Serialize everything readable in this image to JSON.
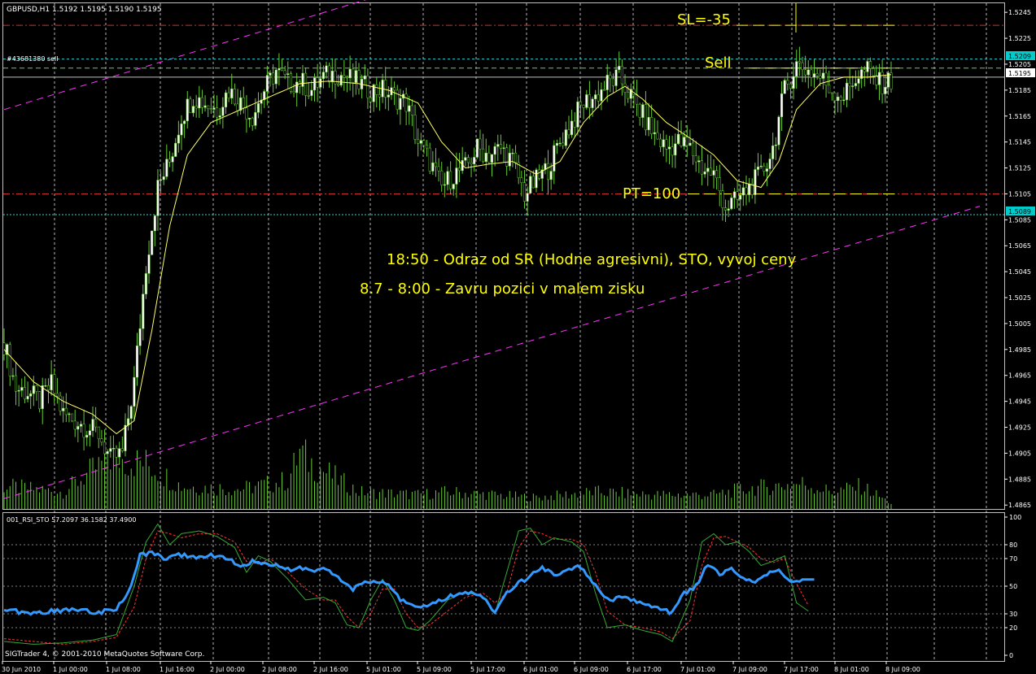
{
  "header": {
    "symbol_info": "GBPUSD,H1  1.5192 1.5195 1.5190 1.5195",
    "order_label": "#43681380 sell"
  },
  "colors": {
    "background": "#000000",
    "bull_candle": "#ffffff",
    "bear_candle": "#000000",
    "wick": "#66cc33",
    "ma_line": "#ffff66",
    "channel": "#ff33ff",
    "sl_tp_line": "#cc3333",
    "order_line": "#66cc66",
    "current_price_line": "#c0c0c0",
    "rsi_line": "#3399ff",
    "sto_main": "#33aa33",
    "sto_signal": "#ff3333",
    "volume": "#66cc33",
    "price_tag_blue": "#00cccc"
  },
  "annotations": {
    "sl": "SL=-35",
    "sell": "Sell",
    "pt": "PT=100",
    "note1": "18:50 - Odraz od SR (Hodne agresivni), STO, vyvoj ceny",
    "note2": "8.7 - 8:00 - Zavru pozici v malem zisku"
  },
  "price_tags": {
    "order_price": "1.5209",
    "current_price": "1.5195",
    "support_price": "1.5089"
  },
  "indicator": {
    "title": "001_RSI_STO  57.2097 36.1582 37.4900"
  },
  "footer": {
    "copyright": "SIGTrader 4, © 2001-2010 MetaQuotes Software Corp."
  },
  "chart_data": {
    "type": "candlestick",
    "symbol": "GBPUSD",
    "timeframe": "H1",
    "y_ticks": [
      "1.5245",
      "1.5225",
      "1.5205",
      "1.5185",
      "1.5165",
      "1.5145",
      "1.5125",
      "1.5105",
      "1.5085",
      "1.5065",
      "1.5045",
      "1.5025",
      "1.5005",
      "1.4985",
      "1.4965",
      "1.4945",
      "1.4925",
      "1.4905",
      "1.4885",
      "1.4865"
    ],
    "ylim": [
      1.4862,
      1.5252
    ],
    "x_ticks": [
      "30 Jun 2010",
      "1 Jul 00:00",
      "1 Jul 08:00",
      "1 Jul 16:00",
      "2 Jul 00:00",
      "2 Jul 08:00",
      "2 Jul 16:00",
      "5 Jul 01:00",
      "5 Jul 09:00",
      "5 Jul 17:00",
      "6 Jul 01:00",
      "6 Jul 09:00",
      "6 Jul 17:00",
      "7 Jul 01:00",
      "7 Jul 09:00",
      "7 Jul 17:00",
      "8 Jul 01:00",
      "8 Jul 09:00"
    ],
    "levels": {
      "stop_loss": 1.5235,
      "order_open": 1.5209,
      "sell_line": 1.5202,
      "current": 1.5195,
      "take_profit": 1.5105,
      "support": 1.5089
    },
    "close_anchors": [
      [
        0,
        1.499
      ],
      [
        4,
        1.4955
      ],
      [
        8,
        1.4952
      ],
      [
        12,
        1.4945
      ],
      [
        16,
        1.4958
      ],
      [
        20,
        1.4935
      ],
      [
        24,
        1.493
      ],
      [
        28,
        1.4925
      ],
      [
        32,
        1.492
      ],
      [
        36,
        1.49
      ],
      [
        40,
        1.4905
      ],
      [
        44,
        1.496
      ],
      [
        48,
        1.505
      ],
      [
        52,
        1.511
      ],
      [
        56,
        1.513
      ],
      [
        60,
        1.5165
      ],
      [
        64,
        1.518
      ],
      [
        68,
        1.5175
      ],
      [
        72,
        1.517
      ],
      [
        76,
        1.5185
      ],
      [
        80,
        1.5175
      ],
      [
        84,
        1.5165
      ],
      [
        88,
        1.5185
      ],
      [
        92,
        1.52
      ],
      [
        96,
        1.519
      ],
      [
        100,
        1.5192
      ],
      [
        104,
        1.5185
      ],
      [
        108,
        1.5195
      ],
      [
        112,
        1.5198
      ],
      [
        116,
        1.5195
      ],
      [
        120,
        1.519
      ],
      [
        124,
        1.5185
      ],
      [
        128,
        1.5185
      ],
      [
        132,
        1.518
      ],
      [
        136,
        1.5175
      ],
      [
        140,
        1.5145
      ],
      [
        144,
        1.513
      ],
      [
        148,
        1.511
      ],
      [
        152,
        1.512
      ],
      [
        156,
        1.5125
      ],
      [
        160,
        1.514
      ],
      [
        164,
        1.5135
      ],
      [
        168,
        1.514
      ],
      [
        172,
        1.513
      ],
      [
        176,
        1.5105
      ],
      [
        180,
        1.5115
      ],
      [
        184,
        1.5125
      ],
      [
        188,
        1.5145
      ],
      [
        192,
        1.516
      ],
      [
        196,
        1.5175
      ],
      [
        200,
        1.518
      ],
      [
        204,
        1.519
      ],
      [
        208,
        1.5195
      ],
      [
        212,
        1.518
      ],
      [
        216,
        1.5165
      ],
      [
        220,
        1.515
      ],
      [
        224,
        1.514
      ],
      [
        228,
        1.5145
      ],
      [
        232,
        1.514
      ],
      [
        236,
        1.5125
      ],
      [
        240,
        1.512
      ],
      [
        244,
        1.5095
      ],
      [
        248,
        1.51
      ],
      [
        252,
        1.511
      ],
      [
        256,
        1.512
      ],
      [
        260,
        1.514
      ],
      [
        264,
        1.5185
      ],
      [
        268,
        1.5205
      ],
      [
        272,
        1.52
      ],
      [
        276,
        1.5195
      ],
      [
        280,
        1.5185
      ],
      [
        284,
        1.518
      ],
      [
        288,
        1.5195
      ],
      [
        292,
        1.52
      ],
      [
        296,
        1.519
      ],
      [
        300,
        1.5192
      ]
    ],
    "ma_anchors": [
      [
        0,
        1.4985
      ],
      [
        10,
        1.496
      ],
      [
        20,
        1.4945
      ],
      [
        30,
        1.4935
      ],
      [
        38,
        1.492
      ],
      [
        44,
        1.493
      ],
      [
        50,
        1.5
      ],
      [
        56,
        1.508
      ],
      [
        62,
        1.5135
      ],
      [
        70,
        1.516
      ],
      [
        80,
        1.517
      ],
      [
        90,
        1.518
      ],
      [
        100,
        1.519
      ],
      [
        110,
        1.5192
      ],
      [
        120,
        1.519
      ],
      [
        130,
        1.5185
      ],
      [
        140,
        1.5175
      ],
      [
        148,
        1.5145
      ],
      [
        156,
        1.5125
      ],
      [
        164,
        1.5128
      ],
      [
        172,
        1.513
      ],
      [
        180,
        1.512
      ],
      [
        188,
        1.513
      ],
      [
        196,
        1.516
      ],
      [
        204,
        1.518
      ],
      [
        210,
        1.5188
      ],
      [
        216,
        1.5178
      ],
      [
        224,
        1.516
      ],
      [
        232,
        1.5148
      ],
      [
        240,
        1.5135
      ],
      [
        248,
        1.5115
      ],
      [
        256,
        1.511
      ],
      [
        262,
        1.513
      ],
      [
        268,
        1.517
      ],
      [
        276,
        1.519
      ],
      [
        284,
        1.5195
      ],
      [
        292,
        1.5195
      ],
      [
        300,
        1.5197
      ]
    ],
    "volume_anchors": [
      [
        0,
        40
      ],
      [
        20,
        30
      ],
      [
        36,
        90
      ],
      [
        48,
        80
      ],
      [
        60,
        40
      ],
      [
        80,
        35
      ],
      [
        96,
        50
      ],
      [
        100,
        100
      ],
      [
        104,
        80
      ],
      [
        120,
        30
      ],
      [
        140,
        25
      ],
      [
        150,
        30
      ],
      [
        180,
        20
      ],
      [
        200,
        30
      ],
      [
        220,
        25
      ],
      [
        240,
        25
      ],
      [
        250,
        35
      ],
      [
        260,
        40
      ],
      [
        270,
        45
      ],
      [
        280,
        30
      ],
      [
        290,
        40
      ],
      [
        300,
        10
      ]
    ],
    "channel": {
      "upper": {
        "x0": 0,
        "y0": 1.517,
        "x1": 130,
        "y1": 1.526
      },
      "lower": {
        "x0": 0,
        "y0": 1.487,
        "x1": 300,
        "y1": 1.5075
      }
    },
    "indicator_panel": {
      "name": "001_RSI_STO",
      "y_ticks": [
        "100",
        "80",
        "70",
        "50",
        "30",
        "20",
        "0"
      ],
      "levels": [
        100,
        80,
        70,
        50,
        30,
        20,
        0
      ],
      "ylim": [
        0,
        100
      ],
      "rsi_anchors": [
        [
          0,
          34
        ],
        [
          8,
          30
        ],
        [
          16,
          32
        ],
        [
          24,
          33
        ],
        [
          32,
          31
        ],
        [
          38,
          34
        ],
        [
          42,
          45
        ],
        [
          46,
          72
        ],
        [
          50,
          75
        ],
        [
          54,
          70
        ],
        [
          58,
          73
        ],
        [
          64,
          71
        ],
        [
          70,
          72
        ],
        [
          76,
          70
        ],
        [
          80,
          64
        ],
        [
          84,
          68
        ],
        [
          90,
          66
        ],
        [
          96,
          62
        ],
        [
          100,
          64
        ],
        [
          104,
          60
        ],
        [
          108,
          62
        ],
        [
          112,
          58
        ],
        [
          118,
          48
        ],
        [
          122,
          52
        ],
        [
          126,
          54
        ],
        [
          130,
          50
        ],
        [
          134,
          40
        ],
        [
          138,
          36
        ],
        [
          142,
          35
        ],
        [
          146,
          38
        ],
        [
          150,
          42
        ],
        [
          154,
          44
        ],
        [
          158,
          45
        ],
        [
          162,
          42
        ],
        [
          166,
          30
        ],
        [
          170,
          45
        ],
        [
          174,
          52
        ],
        [
          178,
          57
        ],
        [
          182,
          64
        ],
        [
          186,
          58
        ],
        [
          190,
          60
        ],
        [
          194,
          66
        ],
        [
          198,
          56
        ],
        [
          202,
          44
        ],
        [
          206,
          40
        ],
        [
          210,
          43
        ],
        [
          214,
          38
        ],
        [
          218,
          36
        ],
        [
          222,
          33
        ],
        [
          226,
          31
        ],
        [
          230,
          45
        ],
        [
          234,
          50
        ],
        [
          238,
          66
        ],
        [
          242,
          58
        ],
        [
          246,
          62
        ],
        [
          250,
          56
        ],
        [
          254,
          54
        ],
        [
          258,
          58
        ],
        [
          262,
          63
        ],
        [
          266,
          52
        ],
        [
          270,
          55
        ],
        [
          274,
          55
        ]
      ],
      "sto_main_anchors": [
        [
          0,
          10
        ],
        [
          10,
          8
        ],
        [
          20,
          9
        ],
        [
          30,
          11
        ],
        [
          38,
          15
        ],
        [
          44,
          50
        ],
        [
          48,
          82
        ],
        [
          52,
          95
        ],
        [
          56,
          80
        ],
        [
          60,
          88
        ],
        [
          66,
          90
        ],
        [
          72,
          86
        ],
        [
          78,
          78
        ],
        [
          82,
          60
        ],
        [
          86,
          72
        ],
        [
          90,
          68
        ],
        [
          96,
          55
        ],
        [
          102,
          40
        ],
        [
          108,
          42
        ],
        [
          112,
          38
        ],
        [
          116,
          22
        ],
        [
          120,
          20
        ],
        [
          124,
          40
        ],
        [
          128,
          55
        ],
        [
          132,
          40
        ],
        [
          136,
          20
        ],
        [
          140,
          18
        ],
        [
          144,
          25
        ],
        [
          150,
          40
        ],
        [
          156,
          46
        ],
        [
          162,
          42
        ],
        [
          166,
          30
        ],
        [
          170,
          60
        ],
        [
          174,
          90
        ],
        [
          178,
          92
        ],
        [
          182,
          80
        ],
        [
          186,
          85
        ],
        [
          192,
          82
        ],
        [
          196,
          75
        ],
        [
          200,
          45
        ],
        [
          204,
          20
        ],
        [
          210,
          22
        ],
        [
          216,
          18
        ],
        [
          222,
          15
        ],
        [
          226,
          10
        ],
        [
          232,
          40
        ],
        [
          236,
          82
        ],
        [
          240,
          88
        ],
        [
          244,
          80
        ],
        [
          248,
          82
        ],
        [
          252,
          75
        ],
        [
          256,
          65
        ],
        [
          260,
          68
        ],
        [
          264,
          72
        ],
        [
          268,
          38
        ],
        [
          272,
          32
        ]
      ],
      "sto_signal_anchors": [
        [
          0,
          12
        ],
        [
          10,
          10
        ],
        [
          20,
          8
        ],
        [
          30,
          10
        ],
        [
          38,
          13
        ],
        [
          44,
          35
        ],
        [
          48,
          70
        ],
        [
          52,
          90
        ],
        [
          56,
          88
        ],
        [
          60,
          85
        ],
        [
          66,
          88
        ],
        [
          72,
          88
        ],
        [
          78,
          82
        ],
        [
          82,
          68
        ],
        [
          86,
          66
        ],
        [
          90,
          70
        ],
        [
          96,
          60
        ],
        [
          102,
          48
        ],
        [
          108,
          40
        ],
        [
          112,
          40
        ],
        [
          116,
          28
        ],
        [
          120,
          20
        ],
        [
          124,
          30
        ],
        [
          128,
          48
        ],
        [
          132,
          48
        ],
        [
          136,
          30
        ],
        [
          140,
          20
        ],
        [
          144,
          22
        ],
        [
          150,
          32
        ],
        [
          156,
          42
        ],
        [
          162,
          45
        ],
        [
          166,
          38
        ],
        [
          170,
          45
        ],
        [
          174,
          78
        ],
        [
          178,
          90
        ],
        [
          182,
          88
        ],
        [
          186,
          84
        ],
        [
          192,
          84
        ],
        [
          196,
          80
        ],
        [
          200,
          60
        ],
        [
          204,
          32
        ],
        [
          210,
          22
        ],
        [
          216,
          20
        ],
        [
          222,
          17
        ],
        [
          226,
          12
        ],
        [
          232,
          25
        ],
        [
          236,
          65
        ],
        [
          240,
          85
        ],
        [
          244,
          86
        ],
        [
          248,
          82
        ],
        [
          252,
          78
        ],
        [
          256,
          70
        ],
        [
          260,
          67
        ],
        [
          264,
          70
        ],
        [
          268,
          52
        ],
        [
          272,
          36
        ]
      ]
    }
  }
}
